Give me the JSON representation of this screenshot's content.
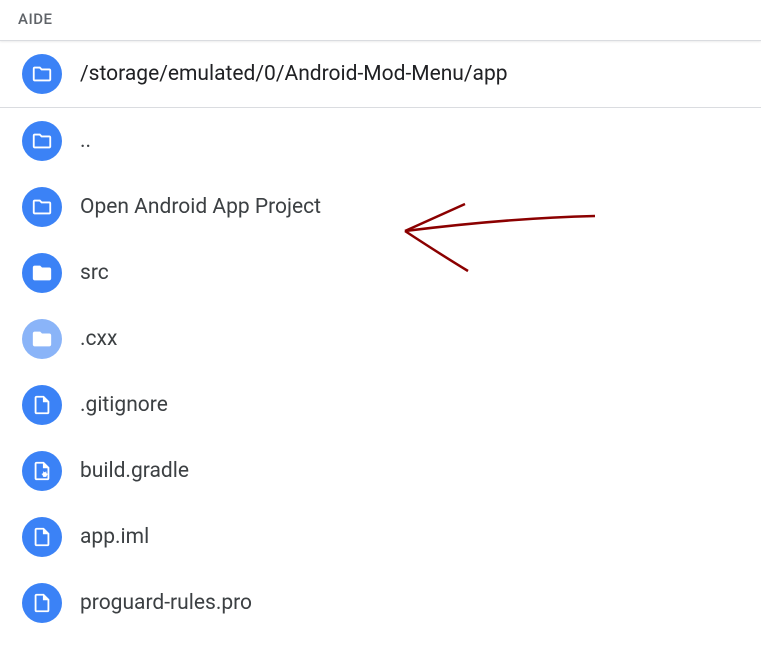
{
  "header": {
    "title": "AIDE"
  },
  "path": "/storage/emulated/0/Android-Mod-Menu/app",
  "items": [
    {
      "name": "..",
      "icon": "folder-open"
    },
    {
      "name": "Open Android App Project",
      "icon": "folder-open"
    },
    {
      "name": "src",
      "icon": "folder"
    },
    {
      "name": ".cxx",
      "icon": "folder-grey"
    },
    {
      "name": ".gitignore",
      "icon": "file"
    },
    {
      "name": "build.gradle",
      "icon": "file-gear"
    },
    {
      "name": "app.iml",
      "icon": "file"
    },
    {
      "name": "proguard-rules.pro",
      "icon": "file"
    }
  ],
  "colors": {
    "iconBlue": "#3b82f6",
    "iconGrey": "#8ab4f8",
    "annotationRed": "#8b0000"
  }
}
